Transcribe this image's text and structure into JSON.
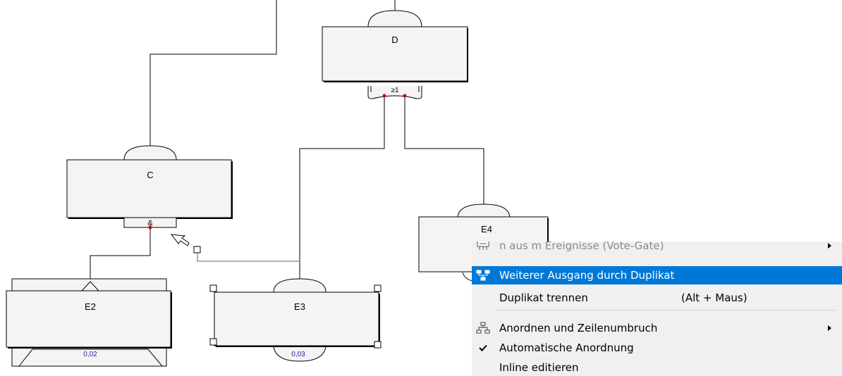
{
  "diagram": {
    "nodes": [
      {
        "id": "D",
        "label": "D",
        "gate_symbol": "≥1"
      },
      {
        "id": "C",
        "label": "C",
        "gate_symbol": "&"
      },
      {
        "id": "E4",
        "label": "E4"
      },
      {
        "id": "E2",
        "label": "E2",
        "value": "0,02"
      },
      {
        "id": "E3",
        "label": "E3",
        "value": "0,03"
      }
    ]
  },
  "context_menu": {
    "items": [
      {
        "label": "n aus m Ereignisse (Vote-Gate)",
        "icon": "vote-gate-icon",
        "disabled": true,
        "submenu": true
      },
      {
        "label": "Weiterer Ausgang durch Duplikat",
        "icon": "duplicate-output-icon",
        "highlighted": true
      },
      {
        "label": "Duplikat trennen",
        "shortcut": "(Alt + Maus)"
      },
      {
        "label": "Anordnen und Zeilenumbruch",
        "icon": "arrange-icon",
        "submenu": true
      },
      {
        "label": "Automatische Anordnung",
        "icon": "checkmark-icon",
        "checked": true
      },
      {
        "label": "Inline editieren"
      }
    ]
  },
  "colors": {
    "menu_highlight": "#0078d7",
    "menu_background": "#f0f0f0",
    "node_fill": "#f4f4f4",
    "value_text": "#1a1aa0",
    "connector_dot": "#cc0000"
  }
}
